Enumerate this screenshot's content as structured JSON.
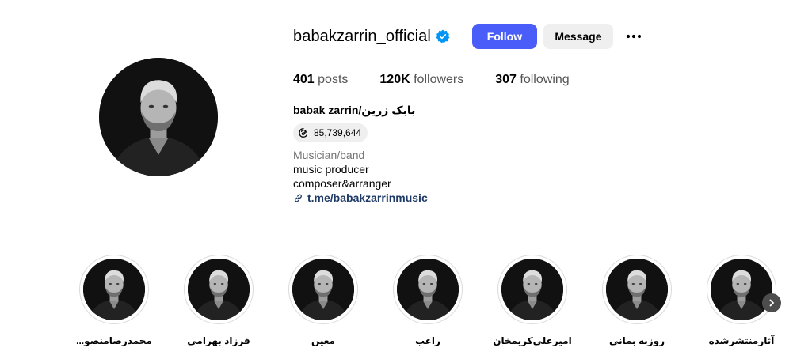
{
  "profile": {
    "username": "babakzarrin_official",
    "verified": true,
    "follow_label": "Follow",
    "message_label": "Message",
    "posts_count": "401",
    "posts_label": "posts",
    "followers_count": "120K",
    "followers_label": "followers",
    "following_count": "307",
    "following_label": "following",
    "full_name": "بابک زرین/babak zarrin",
    "threads_count": "85,739,644",
    "category": "Musician/band",
    "bio": [
      "music producer",
      "composer&arranger"
    ],
    "link": "t.me/babakzarrinmusic"
  },
  "highlights": [
    {
      "label": "محمدرضامنصو..."
    },
    {
      "label": "فرزاد بهرامی"
    },
    {
      "label": "معین"
    },
    {
      "label": "راغب"
    },
    {
      "label": "امیرعلی‌کریمخان"
    },
    {
      "label": "روزبه بمانی"
    },
    {
      "label": "آثارمنتشرشده"
    }
  ],
  "colors": {
    "follow_button": "#4a5df9",
    "secondary_button": "#efefef",
    "verified_badge": "#0095f6",
    "link": "#1e3a66"
  },
  "icons": {
    "verified": "verified-badge-icon",
    "more": "more-options-icon",
    "threads": "threads-icon",
    "link": "link-icon",
    "next": "chevron-right-icon"
  }
}
